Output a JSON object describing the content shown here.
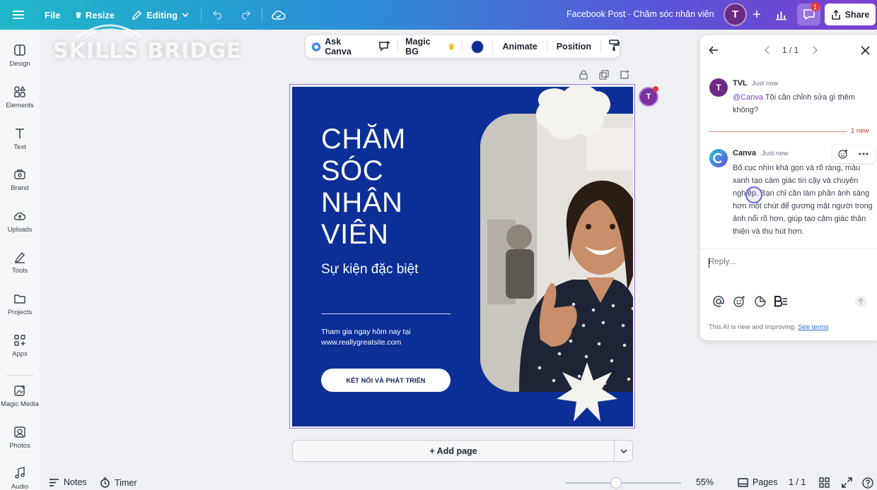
{
  "topbar": {
    "file_label": "File",
    "resize_label": "Resize",
    "editing_label": "Editing",
    "doc_title": "Facebook Post - Chăm sóc nhân viên",
    "avatar_initial": "T",
    "notification_count": "1",
    "share_label": "Share"
  },
  "watermark": "SKILLS BRIDGE",
  "sidebar": {
    "items": [
      {
        "label": "Design"
      },
      {
        "label": "Elements"
      },
      {
        "label": "Text"
      },
      {
        "label": "Brand"
      },
      {
        "label": "Uploads"
      },
      {
        "label": "Tools"
      },
      {
        "label": "Projects"
      },
      {
        "label": "Apps"
      },
      {
        "label": "Magic Media"
      },
      {
        "label": "Photos"
      },
      {
        "label": "Audio"
      }
    ]
  },
  "float_toolbar": {
    "ask_canva": "Ask Canva",
    "magic_bg": "Magic BG",
    "color": "#0b2f96",
    "animate": "Animate",
    "position": "Position"
  },
  "design": {
    "title": "CHĂM SÓC NHÂN VIÊN",
    "subtitle": "Sự kiện đặc biệt",
    "info_line1": "Tham gia ngay hôm nay tại",
    "info_line2": "www.reallygreatsite.com",
    "button": "KẾT NỐI VÀ PHÁT TRIỂN",
    "floating_avatar": "T"
  },
  "add_page": "+ Add page",
  "bottombar": {
    "notes": "Notes",
    "timer": "Timer",
    "zoom_level": 55,
    "zoom": "55%",
    "pages": "Pages",
    "page_count": "1 / 1"
  },
  "panel": {
    "pager": "1 / 1",
    "comment1": {
      "avatar": "T",
      "name": "TVL",
      "time": "Just now",
      "mention": "@Canva",
      "text": " Tôi cần chỉnh sửa gì thêm không?"
    },
    "new_label": "1 new",
    "comment2": {
      "name": "Canva",
      "time": "Just now",
      "text": "Bố cục nhìn khá gọn và rõ ràng, màu xanh tạo cảm giác tin cậy và chuyên nghiệp. Bạn chỉ cần làm phần ảnh sáng hơn một chút để gương mặt người trong ảnh nổi rõ hơn, giúp tạo cảm giác thân thiện và thu hút hơn."
    },
    "reply_placeholder": "Reply...",
    "ai_note": "This AI is new and improving.",
    "see_terms": "See terms"
  }
}
